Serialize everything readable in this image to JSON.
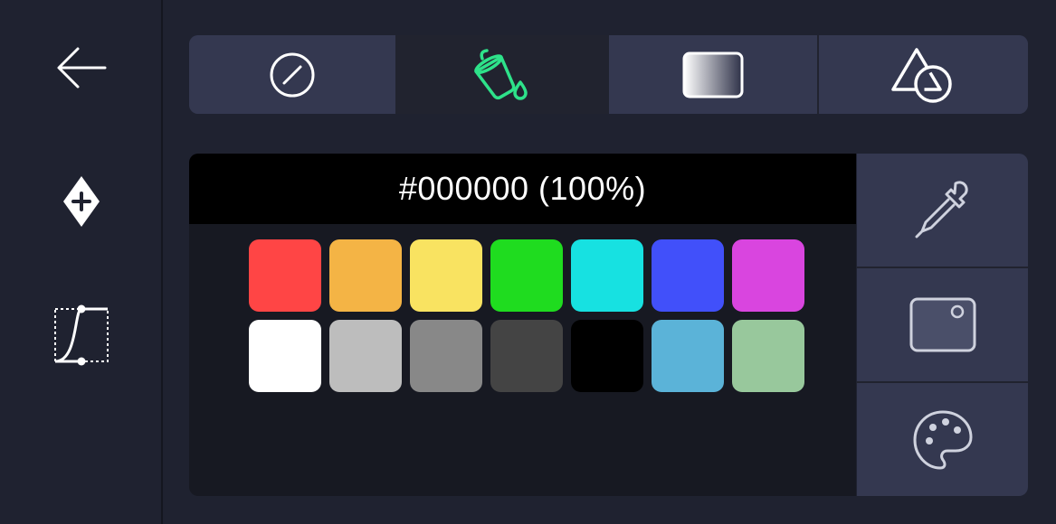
{
  "rail": {
    "icons": [
      "back-arrow-icon",
      "add-node-icon",
      "bezier-curve-icon"
    ]
  },
  "tabs": [
    {
      "id": "none",
      "icon": "no-fill-icon",
      "active": false
    },
    {
      "id": "fill",
      "icon": "paint-bucket-icon",
      "active": true
    },
    {
      "id": "gradient",
      "icon": "gradient-icon",
      "active": false
    },
    {
      "id": "shape",
      "icon": "shapes-icon",
      "active": false
    }
  ],
  "color": {
    "current": "#000000 (100%)"
  },
  "swatches": [
    "#ff4545",
    "#f4b445",
    "#f9e361",
    "#1fdc1f",
    "#17e1e1",
    "#4150fa",
    "#d945df",
    "#ffffff",
    "#bdbdbd",
    "#888888",
    "#444444",
    "#000000",
    "#5bb3d8",
    "#98c89c"
  ],
  "colors": {
    "accent": "#2ee28a",
    "background": "#1f2230",
    "tab_bg": "#343850",
    "panel_bg": "#171922"
  },
  "side_tools": [
    "eyedropper-icon",
    "image-picker-icon",
    "palette-icon"
  ]
}
